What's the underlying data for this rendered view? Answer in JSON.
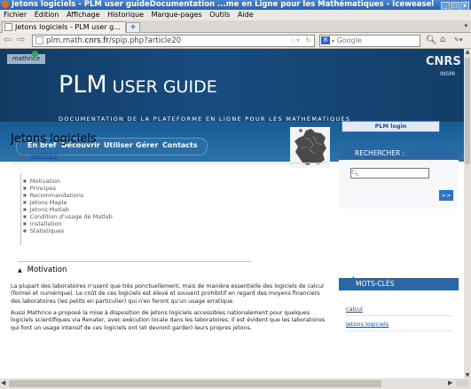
{
  "window": {
    "title": "Jetons logiciels - PLM user guideDocumentation ...me en Ligne pour les Mathématiques - Iceweasel",
    "buttons": [
      "_",
      "□",
      "x"
    ]
  },
  "menubar": [
    "Fichier",
    "Édition",
    "Affichage",
    "Historique",
    "Marque-pages",
    "Outils",
    "Aide"
  ],
  "tabs": [
    {
      "label": "Jetons logiciels - PLM user g..."
    }
  ],
  "newtab_label": "+",
  "navbar": {
    "url_prefix": "plm.math.",
    "url_domain": "cnrs.fr",
    "url_suffix": "/spip.php?article20",
    "search_placeholder": "Google",
    "search_engine_icon": "8"
  },
  "banner": {
    "logo_text": "mathrice",
    "title_main": "PLM",
    "title_sub": "USER GUIDE",
    "tagline": "DOCUMENTATION DE LA PLATEFORME EN LIGNE POUR LES MATHÉMATIQUES",
    "cnrs_text": "CNRS",
    "insmi_text": "INSMI",
    "nav": [
      "En bref",
      "Découvrir",
      "Utiliser",
      "Gérer",
      "Contacts"
    ]
  },
  "article": {
    "title": "Jetons logiciels",
    "byline_prefix": "par ",
    "author": "mathrice",
    "toc": [
      "Motivation",
      "Principes",
      "Recommandations",
      "Jetons Maple",
      "Jetons Matlab",
      "Condition d'usage de Matlab",
      "Installation",
      "Statistiques"
    ],
    "section_title": "Motivation",
    "paragraph1": "La plupart des laboratoires n'usent que très ponctuellement, mais de manière essentielle des logiciels de calcul (formel et numérique). Le coût de ces logiciels est élevé et souvent prohibitif en regard des moyens financiers des laboratoires (les petits en particulier) qui n'en feront qu'un usage erratique.",
    "paragraph2": "Aussi Mathrice a proposé la mise à disposition de jetons logiciels accessibles nationalement pour quelques logiciels scientifiques via Renater, avec exécution locale dans les laboratoires. Il est évident que les laboratoires qui font un usage intensif de ces logiciels ont (et devront garder) leurs propres jetons."
  },
  "sidebar": {
    "login_label": "PLM login",
    "search_title": "RECHERCHER :",
    "search_button": ">>",
    "keywords_title": "MOTS-CLÉS",
    "keywords": [
      "calcul",
      "jetons logiciels"
    ]
  }
}
